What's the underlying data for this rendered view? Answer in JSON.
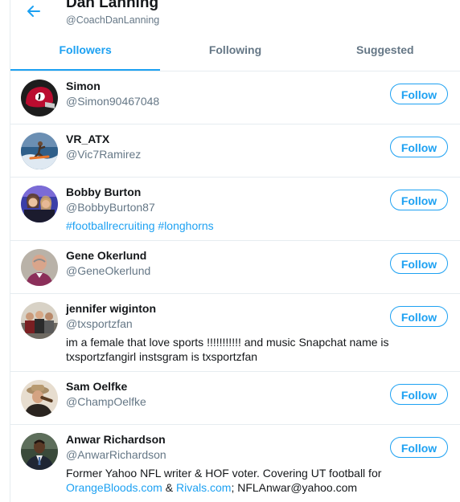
{
  "header": {
    "back_icon": "arrow-left-icon",
    "name": "Dan Lanning",
    "handle": "@CoachDanLanning"
  },
  "tabs": [
    {
      "label": "Followers",
      "active": true
    },
    {
      "label": "Following",
      "active": false
    },
    {
      "label": "Suggested",
      "active": false
    }
  ],
  "colors": {
    "accent": "#1da1f2",
    "text_primary": "#14171a",
    "text_secondary": "#657786",
    "divider": "#e6ecf0"
  },
  "follow_label": "Follow",
  "users": [
    {
      "name": "Simon",
      "handle": "@Simon90467048",
      "avatar_icon": "georgia-helmet-avatar"
    },
    {
      "name": "VR_ATX",
      "handle": "@Vic7Ramirez",
      "avatar_icon": "surfer-avatar"
    },
    {
      "name": "Bobby Burton",
      "handle": "@BobbyBurton87",
      "avatar_icon": "couple-photo-avatar",
      "bio": {
        "hashtag_1": "#footballrecruiting",
        "hashtag_2": "#longhorns"
      }
    },
    {
      "name": "Gene Okerlund",
      "handle": "@GeneOkerlund",
      "avatar_icon": "man-portrait-avatar"
    },
    {
      "name": "jennifer wiginton",
      "handle": "@txsportzfan",
      "avatar_icon": "group-photo-avatar",
      "bio": {
        "text": "im a female that love sports !!!!!!!!!!! and music Snapchat name is txsportzfangirl instsgram is txsportzfan"
      }
    },
    {
      "name": "Sam Oelfke",
      "handle": "@ChampOelfke",
      "avatar_icon": "man-hat-avatar"
    },
    {
      "name": "Anwar Richardson",
      "handle": "@AnwarRichardson",
      "avatar_icon": "man-suit-avatar",
      "bio": {
        "text_before": "Former Yahoo NFL writer & HOF voter. Covering UT football for",
        "link_1": "OrangeBloods.com",
        "sep": " & ",
        "link_2": "Rivals.com",
        "text_after": "; NFLAnwar@yahoo.com"
      }
    }
  ]
}
